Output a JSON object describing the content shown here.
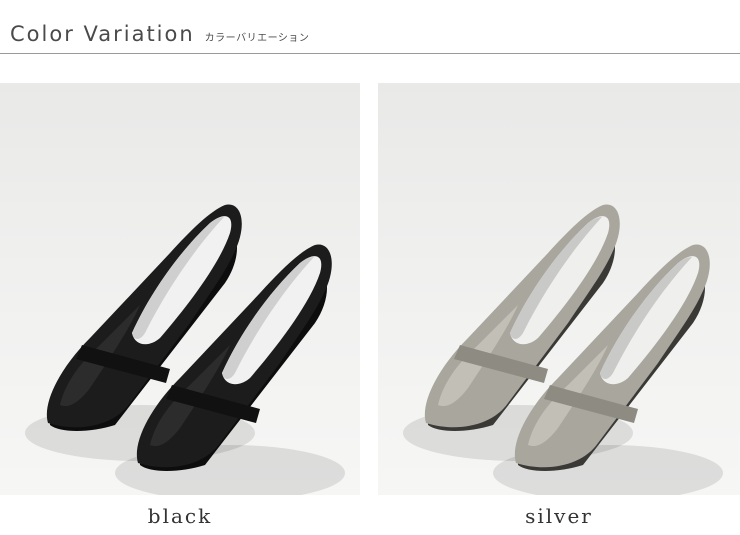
{
  "header": {
    "title": "Color Variation",
    "subtitle": "カラーバリエーション"
  },
  "variations": [
    {
      "label": "black",
      "colors": {
        "upper": "#1c1c1c",
        "upper_highlight": "#3a3a3a",
        "lining": "#f1f1f1",
        "lining_shadow": "#cfcfcf",
        "strap": "#111111",
        "sole": "#0d0d0d"
      }
    },
    {
      "label": "silver",
      "colors": {
        "upper": "#a9a69d",
        "upper_highlight": "#d6d3cb",
        "lining": "#efefee",
        "lining_shadow": "#c9c9c7",
        "strap": "#8e8b83",
        "sole": "#3a3936"
      }
    }
  ]
}
